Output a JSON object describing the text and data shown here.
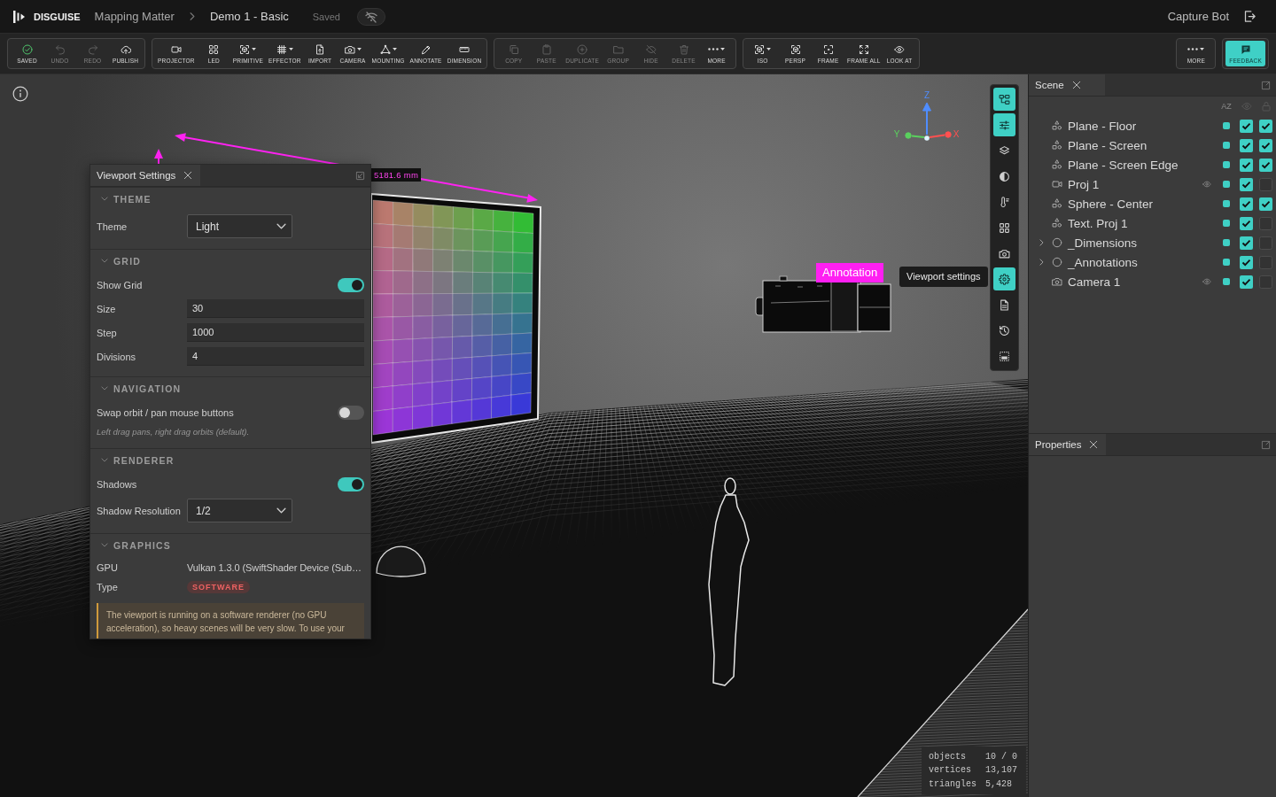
{
  "top_bar": {
    "brand": "DISGUISE",
    "breadcrumbs": [
      {
        "label": "Mapping Matter"
      },
      {
        "label": "Demo 1 - Basic"
      }
    ],
    "save_status": "Saved",
    "online": false,
    "user": "Capture Bot"
  },
  "toolbar": {
    "left_groups": [
      {
        "buttons": [
          {
            "kind": "saved",
            "label": "SAVED",
            "disabled": false,
            "dropdown": false,
            "primary": false
          },
          {
            "kind": "undo",
            "label": "UNDO",
            "disabled": true,
            "dropdown": false,
            "primary": false
          },
          {
            "kind": "redo",
            "label": "REDO",
            "disabled": true,
            "dropdown": false,
            "primary": false
          },
          {
            "kind": "publish",
            "label": "PUBLISH",
            "disabled": false,
            "dropdown": false,
            "primary": false
          }
        ]
      },
      {
        "buttons": [
          {
            "kind": "projector",
            "label": "PROJECTOR",
            "disabled": false,
            "dropdown": false,
            "primary": false
          },
          {
            "kind": "led",
            "label": "LED",
            "disabled": false,
            "dropdown": false,
            "primary": false
          },
          {
            "kind": "primitive",
            "label": "PRIMITIVE",
            "disabled": false,
            "dropdown": true,
            "primary": false
          },
          {
            "kind": "effector",
            "label": "EFFECTOR",
            "disabled": false,
            "dropdown": true,
            "primary": false
          },
          {
            "kind": "import",
            "label": "IMPORT",
            "disabled": false,
            "dropdown": false,
            "primary": false
          },
          {
            "kind": "camera",
            "label": "CAMERA",
            "disabled": false,
            "dropdown": true,
            "primary": false
          },
          {
            "kind": "mounting",
            "label": "MOUNTING",
            "disabled": false,
            "dropdown": true,
            "primary": false
          },
          {
            "kind": "annotate",
            "label": "ANNOTATE",
            "disabled": false,
            "dropdown": false,
            "primary": false
          },
          {
            "kind": "dimension",
            "label": "DIMENSION",
            "disabled": false,
            "dropdown": false,
            "primary": false
          }
        ]
      },
      {
        "buttons": [
          {
            "kind": "copy",
            "label": "COPY",
            "disabled": true,
            "dropdown": false,
            "primary": false
          },
          {
            "kind": "paste",
            "label": "PASTE",
            "disabled": true,
            "dropdown": false,
            "primary": false
          },
          {
            "kind": "duplicate",
            "label": "DUPLICATE",
            "disabled": true,
            "dropdown": false,
            "primary": false
          },
          {
            "kind": "group",
            "label": "GROUP",
            "disabled": true,
            "dropdown": false,
            "primary": false
          },
          {
            "kind": "hide",
            "label": "HIDE",
            "disabled": true,
            "dropdown": false,
            "primary": false
          },
          {
            "kind": "delete",
            "label": "DELETE",
            "disabled": true,
            "dropdown": false,
            "primary": false
          },
          {
            "kind": "more",
            "label": "MORE",
            "disabled": false,
            "dropdown": true,
            "primary": false
          }
        ]
      },
      {
        "buttons": [
          {
            "kind": "iso",
            "label": "ISO",
            "disabled": false,
            "dropdown": true,
            "primary": false
          },
          {
            "kind": "persp",
            "label": "PERSP",
            "disabled": false,
            "dropdown": false,
            "primary": false
          },
          {
            "kind": "frame",
            "label": "FRAME",
            "disabled": false,
            "dropdown": false,
            "primary": false
          },
          {
            "kind": "frame_all",
            "label": "FRAME ALL",
            "disabled": false,
            "dropdown": false,
            "primary": false
          },
          {
            "kind": "look_at",
            "label": "LOOK AT",
            "disabled": false,
            "dropdown": false,
            "primary": false
          }
        ]
      }
    ],
    "right_groups": [
      {
        "buttons": [
          {
            "kind": "more",
            "label": "MORE",
            "disabled": false,
            "dropdown": true,
            "primary": false
          }
        ]
      },
      {
        "buttons": [
          {
            "kind": "feedback",
            "label": "FEEDBACK",
            "disabled": false,
            "dropdown": false,
            "primary": true
          }
        ]
      }
    ]
  },
  "viewport": {
    "dimension_label": "5181.6 mm",
    "annotation": "Annotation",
    "axes": [
      {
        "label": "Z",
        "color": "#4f8dff"
      },
      {
        "label": "Y",
        "color": "#5ad05e"
      },
      {
        "label": "X",
        "color": "#ff5050"
      }
    ],
    "tools": [
      {
        "kind": "hierarchy",
        "selected": true
      },
      {
        "kind": "sliders",
        "selected": true
      },
      {
        "kind": "layers",
        "selected": false
      },
      {
        "kind": "contrast",
        "selected": false
      },
      {
        "kind": "thermometer",
        "selected": false
      },
      {
        "kind": "grid",
        "selected": false
      },
      {
        "kind": "camera",
        "selected": false
      },
      {
        "kind": "settings",
        "selected": true
      },
      {
        "kind": "document",
        "selected": false
      },
      {
        "kind": "history",
        "selected": false
      },
      {
        "kind": "image",
        "selected": false
      }
    ],
    "tooltip": "Viewport settings",
    "stats": [
      {
        "label": "objects",
        "value": "10 / 0"
      },
      {
        "label": "vertices",
        "value": "13,107"
      },
      {
        "label": "triangles",
        "value": "5,428"
      }
    ]
  },
  "viewport_settings": {
    "title": "Viewport Settings",
    "sections": [
      {
        "title": "THEME",
        "expanded": true,
        "rows": [
          {
            "kind": "select",
            "label": "Theme",
            "value": "Light"
          }
        ]
      },
      {
        "title": "GRID",
        "expanded": true,
        "rows": [
          {
            "kind": "toggle",
            "label": "Show Grid",
            "on": true
          },
          {
            "kind": "input",
            "label": "Size",
            "value": "30"
          },
          {
            "kind": "input",
            "label": "Step",
            "value": "1000"
          },
          {
            "kind": "input",
            "label": "Divisions",
            "value": "4"
          }
        ]
      },
      {
        "title": "NAVIGATION",
        "expanded": true,
        "rows": [
          {
            "kind": "toggle",
            "label": "Swap orbit / pan mouse buttons",
            "on": false
          },
          {
            "kind": "hint",
            "text": "Left drag pans, right drag orbits (default)."
          }
        ]
      },
      {
        "title": "RENDERER",
        "expanded": true,
        "rows": [
          {
            "kind": "toggle",
            "label": "Shadows",
            "on": true
          },
          {
            "kind": "select",
            "label": "Shadow Resolution",
            "value": "1/2"
          }
        ]
      },
      {
        "title": "GRAPHICS",
        "expanded": true,
        "rows": [
          {
            "kind": "info",
            "label": "GPU",
            "value": "Vulkan 1.3.0 (SwiftShader Device (Sub…"
          },
          {
            "kind": "badge",
            "label": "Type",
            "value": "SOFTWARE"
          },
          {
            "kind": "warning",
            "text": "The viewport is running on a software renderer (no GPU acceleration), so heavy scenes will be very slow. To use your"
          }
        ]
      }
    ]
  },
  "scene_panel": {
    "title": "Scene",
    "sort_label": "AZ",
    "items": [
      {
        "kind": "mesh",
        "name": "Plane - Floor",
        "visible": true,
        "locked": true
      },
      {
        "kind": "mesh",
        "name": "Plane - Screen",
        "visible": true,
        "locked": true
      },
      {
        "kind": "mesh",
        "name": "Plane - Screen Edge",
        "visible": true,
        "locked": true
      },
      {
        "kind": "projector",
        "name": "Proj 1",
        "visible": true,
        "locked": false
      },
      {
        "kind": "mesh",
        "name": "Sphere - Center",
        "visible": true,
        "locked": true
      },
      {
        "kind": "mesh",
        "name": "Text. Proj 1",
        "visible": true,
        "locked": false
      },
      {
        "kind": "group",
        "name": "_Dimensions",
        "expanded": false,
        "visible": true,
        "locked": false
      },
      {
        "kind": "group",
        "name": "_Annotations",
        "expanded": false,
        "visible": true,
        "locked": false
      },
      {
        "kind": "camera",
        "name": "Camera 1",
        "visible": true,
        "locked": false
      }
    ]
  },
  "properties_panel": {
    "title": "Properties"
  }
}
